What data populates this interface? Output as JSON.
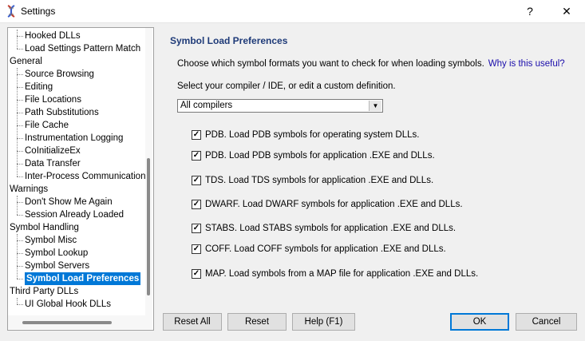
{
  "window": {
    "title": "Settings",
    "help_glyph": "?",
    "close_glyph": "✕"
  },
  "tree": {
    "items": [
      {
        "label": "Hooked DLLs",
        "level": 1
      },
      {
        "label": "Load Settings Pattern Match",
        "level": 1
      },
      {
        "label": "General",
        "level": 0
      },
      {
        "label": "Source Browsing",
        "level": 1
      },
      {
        "label": "Editing",
        "level": 1
      },
      {
        "label": "File Locations",
        "level": 1
      },
      {
        "label": "Path Substitutions",
        "level": 1
      },
      {
        "label": "File Cache",
        "level": 1
      },
      {
        "label": "Instrumentation Logging",
        "level": 1
      },
      {
        "label": "CoInitializeEx",
        "level": 1
      },
      {
        "label": "Data Transfer",
        "level": 1
      },
      {
        "label": "Inter-Process Communication",
        "level": 1
      },
      {
        "label": "Warnings",
        "level": 0
      },
      {
        "label": "Don't Show Me Again",
        "level": 1
      },
      {
        "label": "Session Already Loaded",
        "level": 1
      },
      {
        "label": "Symbol Handling",
        "level": 0
      },
      {
        "label": "Symbol Misc",
        "level": 1
      },
      {
        "label": "Symbol Lookup",
        "level": 1
      },
      {
        "label": "Symbol Servers",
        "level": 1
      },
      {
        "label": "Symbol Load Preferences",
        "level": 1,
        "selected": true
      },
      {
        "label": "Third Party DLLs",
        "level": 0
      },
      {
        "label": "UI Global Hook DLLs",
        "level": 1
      }
    ]
  },
  "panel": {
    "heading": "Symbol Load Preferences",
    "description": "Choose which symbol formats you want to check for when loading symbols.",
    "link": "Why is this useful?",
    "compiler_label": "Select your compiler / IDE, or edit a custom definition.",
    "compiler_value": "All compilers",
    "options": [
      {
        "label": "PDB. Load PDB symbols for operating system DLLs.",
        "checked": true
      },
      {
        "label": "PDB. Load PDB symbols for application .EXE and DLLs.",
        "checked": true
      },
      {
        "label": "TDS. Load TDS symbols for application .EXE and DLLs.",
        "checked": true
      },
      {
        "label": "DWARF. Load DWARF symbols for application .EXE and DLLs.",
        "checked": true
      },
      {
        "label": "STABS. Load STABS symbols for application .EXE and DLLs.",
        "checked": true
      },
      {
        "label": "COFF. Load COFF symbols for application .EXE and DLLs.",
        "checked": true
      },
      {
        "label": "MAP. Load symbols from a MAP file for application .EXE and DLLs.",
        "checked": true
      }
    ]
  },
  "buttons": {
    "reset_all": "Reset All",
    "reset": "Reset",
    "help": "Help (F1)",
    "ok": "OK",
    "cancel": "Cancel"
  },
  "colors": {
    "heading": "#1e3a78",
    "link": "#1a0dab",
    "selection": "#0078d7"
  }
}
